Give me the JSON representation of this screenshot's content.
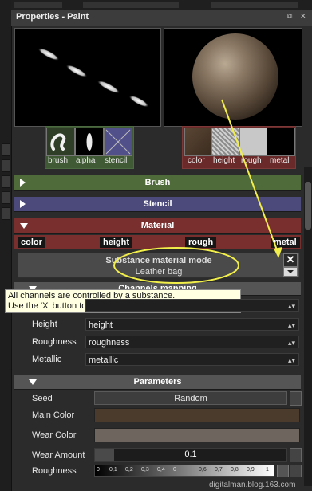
{
  "panel": {
    "title": "Properties - Paint",
    "btn_dock": "⧉",
    "btn_close": "✕"
  },
  "brush_slots": {
    "labels": [
      "brush",
      "alpha",
      "stencil"
    ]
  },
  "material_slots": {
    "labels": [
      "color",
      "height",
      "rough",
      "metal"
    ]
  },
  "sections": {
    "brush": "Brush",
    "stencil": "Stencil",
    "material": "Material",
    "channels": "Channels mapping",
    "parameters": "Parameters"
  },
  "channel_tabs": [
    "color",
    "height",
    "rough",
    "metal"
  ],
  "substance": {
    "mode_label": "Substance material mode",
    "material_name": "Leather bag",
    "close": "✕"
  },
  "tooltip": {
    "line1": "All channels are controlled by a substance.",
    "line2": "Use the 'X' button to switch to separate channels mode"
  },
  "channel_rows": [
    {
      "label": "Height",
      "value": "height"
    },
    {
      "label": "Roughness",
      "value": "roughness"
    },
    {
      "label": "Metallic",
      "value": "metallic"
    }
  ],
  "params": {
    "seed_label": "Seed",
    "seed_value": "Random",
    "main_color_label": "Main Color",
    "wear_color_label": "Wear Color",
    "wear_amount_label": "Wear Amount",
    "wear_amount_value": "0.1",
    "roughness_label": "Roughness",
    "roughness_ticks": [
      "0",
      "0,1",
      "0,2",
      "0,3",
      "0,4",
      "0",
      "0,6",
      "0,7",
      "0,8",
      "0,9",
      "1"
    ]
  },
  "colors": {
    "brush_section": "#4f6b3a",
    "stencil_section": "#4b4a7b",
    "material_section": "#7a2f2f",
    "main_color": "#4b3b2c",
    "wear_color": "#6d655e",
    "annotation": "#f2ef4a"
  },
  "watermark": "digitalman.blog.163.com"
}
